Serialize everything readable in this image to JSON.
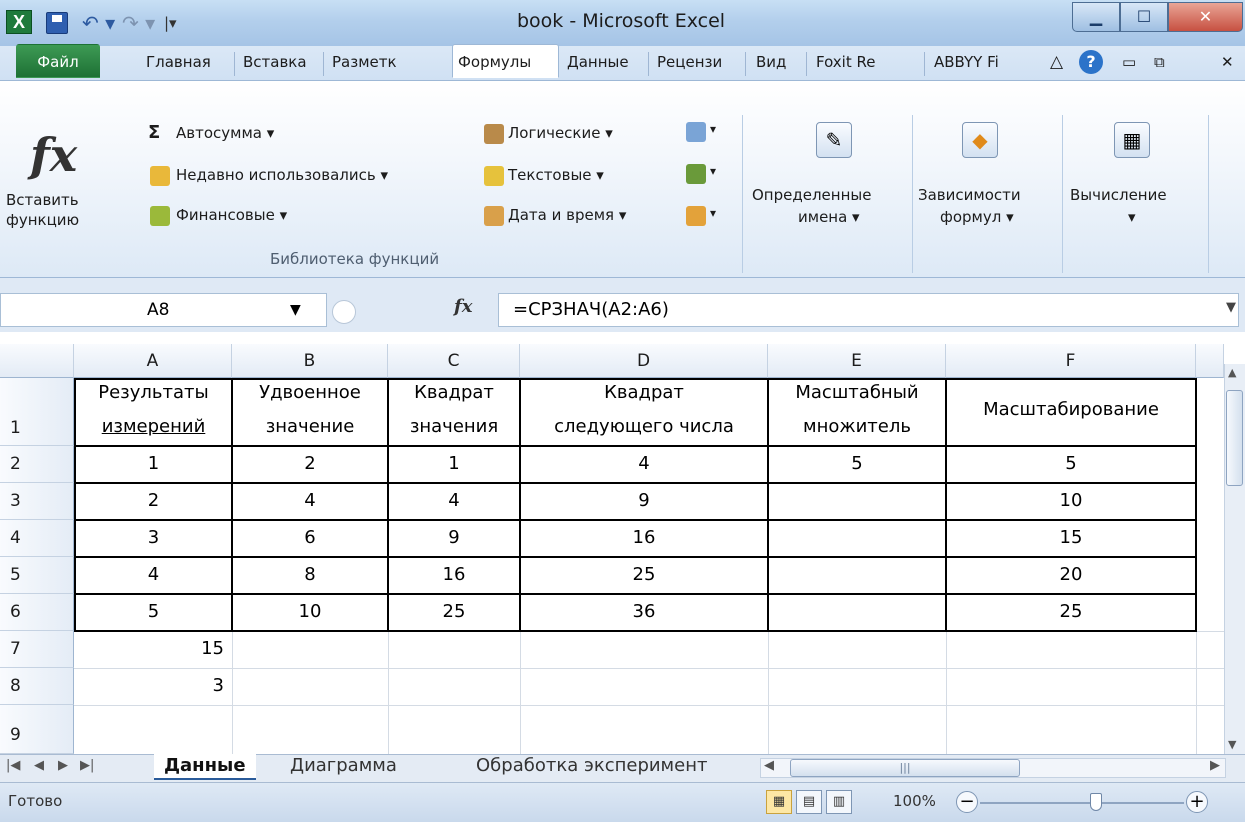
{
  "window": {
    "title": "book - Microsoft Excel"
  },
  "tabs": [
    "Файл",
    "Главная",
    "Вставка",
    "Разметк",
    "Формулы",
    "Данные",
    "Рецензи",
    "Вид",
    "Foxit Re",
    "ABBYY Fi"
  ],
  "ribbon": {
    "insert_function": "Вставить функцию",
    "autosum": "Автосумма ▾",
    "recent": "Недавно использовались ▾",
    "financial": "Финансовые ▾",
    "logical": "Логические ▾",
    "text": "Текстовые ▾",
    "datetime": "Дата и время ▾",
    "group_library": "Библиотека функций",
    "defined_names": "Определенные",
    "defined_names_2": "имена ▾",
    "dependencies": "Зависимости",
    "dependencies_2": "формул ▾",
    "calculation": "Вычисление",
    "calculation_2": "▾"
  },
  "formula_bar": {
    "name_box": "A8",
    "formula": "=СРЗНАЧ(A2:A6)"
  },
  "columns": [
    "A",
    "B",
    "C",
    "D",
    "E",
    "F"
  ],
  "rows": [
    "1",
    "2",
    "3",
    "4",
    "5",
    "6",
    "7",
    "8",
    "9"
  ],
  "headers": {
    "a1": "Результаты",
    "a2": "измерений",
    "b1": "Удвоенное",
    "b2": "значение",
    "c1": "Квадрат",
    "c2": "значения",
    "d1": "Квадрат",
    "d2": "следующего числа",
    "e1": "Масштабный",
    "e2": "множитель",
    "f": "Масштабирование"
  },
  "table": [
    [
      "1",
      "2",
      "1",
      "4",
      "5",
      "5"
    ],
    [
      "2",
      "4",
      "4",
      "9",
      "",
      "10"
    ],
    [
      "3",
      "6",
      "9",
      "16",
      "",
      "15"
    ],
    [
      "4",
      "8",
      "16",
      "25",
      "",
      "20"
    ],
    [
      "5",
      "10",
      "25",
      "36",
      "",
      "25"
    ]
  ],
  "extra": {
    "a7": "15",
    "a8": "3"
  },
  "sheets": [
    "Данные",
    "Диаграмма",
    "Обработка эксперимент"
  ],
  "status": {
    "ready": "Готово",
    "zoom": "100%"
  }
}
